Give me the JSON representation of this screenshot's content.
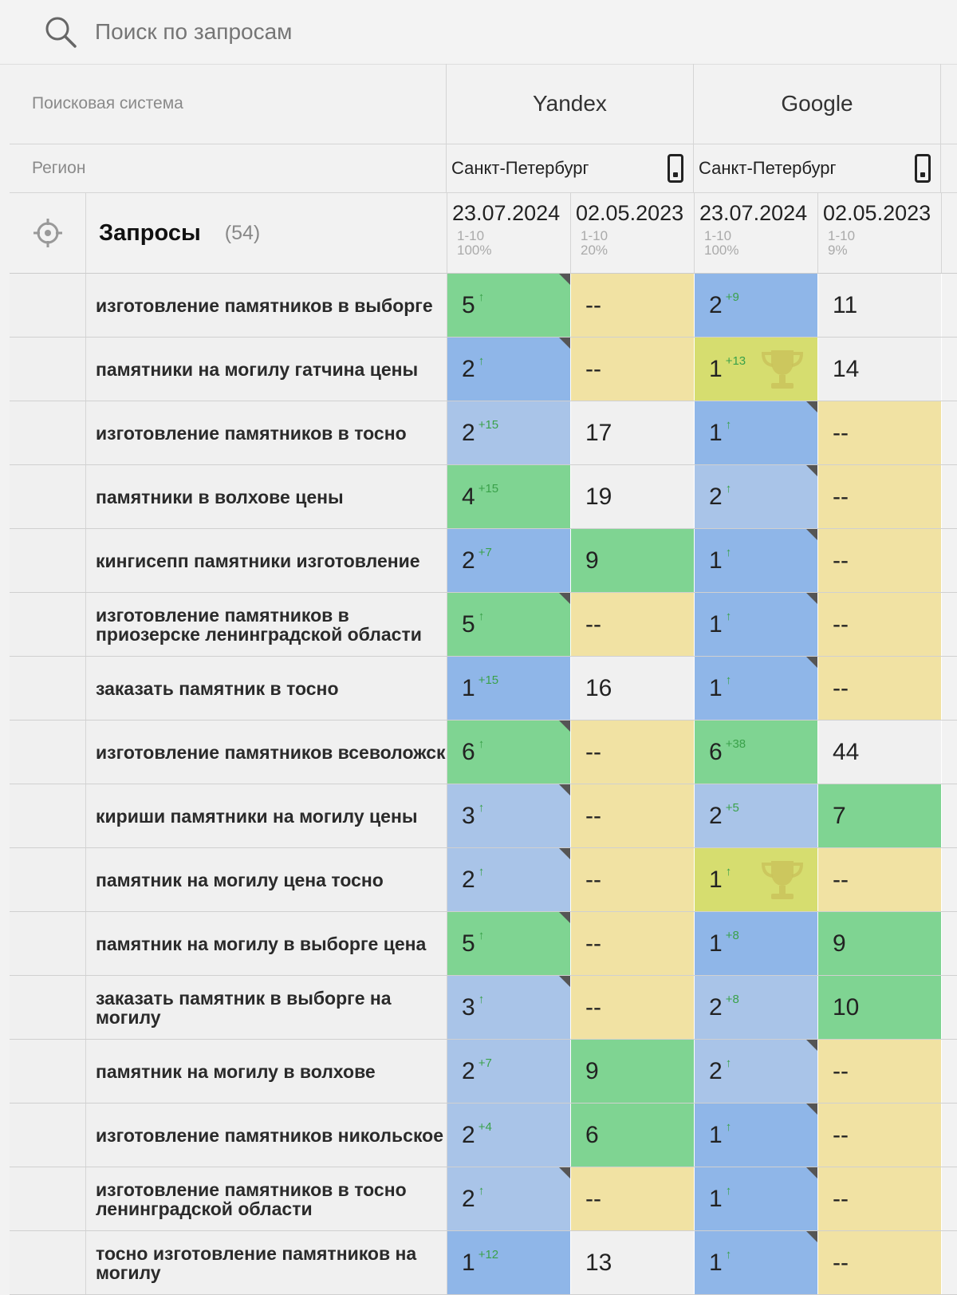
{
  "search": {
    "placeholder": "Поиск по запросам"
  },
  "header": {
    "engine_label": "Поисковая система",
    "region_label": "Регион",
    "engines": [
      {
        "name": "Yandex",
        "region": "Санкт-Петербург"
      },
      {
        "name": "Google",
        "region": "Санкт-Петербург"
      }
    ],
    "queries_title": "Запросы",
    "queries_count": "(54)",
    "dates": [
      {
        "date": "23.07.2024",
        "range": "1-10",
        "pct": "100%"
      },
      {
        "date": "02.05.2023",
        "range": "1-10",
        "pct": "20%"
      },
      {
        "date": "23.07.2024",
        "range": "1-10",
        "pct": "100%"
      },
      {
        "date": "02.05.2023",
        "range": "1-10",
        "pct": "9%"
      }
    ]
  },
  "rows": [
    {
      "q": "изготовление памятников в выборге",
      "c": [
        [
          "5",
          "↑",
          "green",
          1,
          0
        ],
        [
          "--",
          "",
          "yellow",
          0,
          0
        ],
        [
          "2",
          "+9",
          "blue",
          0,
          0
        ],
        [
          "11",
          "",
          "white",
          0,
          0
        ]
      ]
    },
    {
      "q": "памятники на могилу гатчина цены",
      "c": [
        [
          "2",
          "↑",
          "blue",
          1,
          0
        ],
        [
          "--",
          "",
          "yellow",
          0,
          0
        ],
        [
          "1",
          "+13",
          "gold",
          0,
          1
        ],
        [
          "14",
          "",
          "white",
          0,
          0
        ]
      ]
    },
    {
      "q": "изготовление памятников в тосно",
      "c": [
        [
          "2",
          "+15",
          "lblue",
          0,
          0
        ],
        [
          "17",
          "",
          "white",
          0,
          0
        ],
        [
          "1",
          "↑",
          "blue",
          1,
          0
        ],
        [
          "--",
          "",
          "yellow",
          0,
          0
        ]
      ]
    },
    {
      "q": "памятники в волхове цены",
      "c": [
        [
          "4",
          "+15",
          "green",
          0,
          0
        ],
        [
          "19",
          "",
          "white",
          0,
          0
        ],
        [
          "2",
          "↑",
          "lblue",
          1,
          0
        ],
        [
          "--",
          "",
          "yellow",
          0,
          0
        ]
      ]
    },
    {
      "q": "кингисепп памятники изготовление",
      "c": [
        [
          "2",
          "+7",
          "blue",
          0,
          0
        ],
        [
          "9",
          "",
          "green",
          0,
          0
        ],
        [
          "1",
          "↑",
          "blue",
          1,
          0
        ],
        [
          "--",
          "",
          "yellow",
          0,
          0
        ]
      ]
    },
    {
      "q": "изготовление памятников в приозерске ленинградской области",
      "c": [
        [
          "5",
          "↑",
          "green",
          1,
          0
        ],
        [
          "--",
          "",
          "yellow",
          0,
          0
        ],
        [
          "1",
          "↑",
          "blue",
          1,
          0
        ],
        [
          "--",
          "",
          "yellow",
          0,
          0
        ]
      ]
    },
    {
      "q": "заказать памятник в тосно",
      "c": [
        [
          "1",
          "+15",
          "blue",
          0,
          0
        ],
        [
          "16",
          "",
          "white",
          0,
          0
        ],
        [
          "1",
          "↑",
          "blue",
          1,
          0
        ],
        [
          "--",
          "",
          "yellow",
          0,
          0
        ]
      ]
    },
    {
      "q": "изготовление памятников всеволожск",
      "c": [
        [
          "6",
          "↑",
          "green",
          1,
          0
        ],
        [
          "--",
          "",
          "yellow",
          0,
          0
        ],
        [
          "6",
          "+38",
          "green",
          0,
          0
        ],
        [
          "44",
          "",
          "white",
          0,
          0
        ]
      ]
    },
    {
      "q": "кириши памятники на могилу цены",
      "c": [
        [
          "3",
          "↑",
          "lblue",
          1,
          0
        ],
        [
          "--",
          "",
          "yellow",
          0,
          0
        ],
        [
          "2",
          "+5",
          "lblue",
          0,
          0
        ],
        [
          "7",
          "",
          "green",
          0,
          0
        ]
      ]
    },
    {
      "q": "памятник на могилу цена тосно",
      "c": [
        [
          "2",
          "↑",
          "lblue",
          1,
          0
        ],
        [
          "--",
          "",
          "yellow",
          0,
          0
        ],
        [
          "1",
          "↑",
          "gold",
          0,
          1
        ],
        [
          "--",
          "",
          "yellow",
          0,
          0
        ]
      ]
    },
    {
      "q": "памятник на могилу в выборге цена",
      "c": [
        [
          "5",
          "↑",
          "green",
          1,
          0
        ],
        [
          "--",
          "",
          "yellow",
          0,
          0
        ],
        [
          "1",
          "+8",
          "blue",
          0,
          0
        ],
        [
          "9",
          "",
          "green",
          0,
          0
        ]
      ]
    },
    {
      "q": "заказать памятник в выборге на могилу",
      "c": [
        [
          "3",
          "↑",
          "lblue",
          1,
          0
        ],
        [
          "--",
          "",
          "yellow",
          0,
          0
        ],
        [
          "2",
          "+8",
          "lblue",
          0,
          0
        ],
        [
          "10",
          "",
          "green",
          0,
          0
        ]
      ]
    },
    {
      "q": "памятник на могилу в волхове",
      "c": [
        [
          "2",
          "+7",
          "lblue",
          0,
          0
        ],
        [
          "9",
          "",
          "green",
          0,
          0
        ],
        [
          "2",
          "↑",
          "lblue",
          1,
          0
        ],
        [
          "--",
          "",
          "yellow",
          0,
          0
        ]
      ]
    },
    {
      "q": "изготовление памятников никольское",
      "c": [
        [
          "2",
          "+4",
          "lblue",
          0,
          0
        ],
        [
          "6",
          "",
          "green",
          0,
          0
        ],
        [
          "1",
          "↑",
          "blue",
          1,
          0
        ],
        [
          "--",
          "",
          "yellow",
          0,
          0
        ]
      ]
    },
    {
      "q": "изготовление памятников в тосно ленинградской области",
      "c": [
        [
          "2",
          "↑",
          "lblue",
          1,
          0
        ],
        [
          "--",
          "",
          "yellow",
          0,
          0
        ],
        [
          "1",
          "↑",
          "blue",
          1,
          0
        ],
        [
          "--",
          "",
          "yellow",
          0,
          0
        ]
      ]
    },
    {
      "q": "тосно изготовление памятников на могилу",
      "c": [
        [
          "1",
          "+12",
          "blue",
          0,
          0
        ],
        [
          "13",
          "",
          "white",
          0,
          0
        ],
        [
          "1",
          "↑",
          "blue",
          1,
          0
        ],
        [
          "--",
          "",
          "yellow",
          0,
          0
        ]
      ]
    }
  ]
}
